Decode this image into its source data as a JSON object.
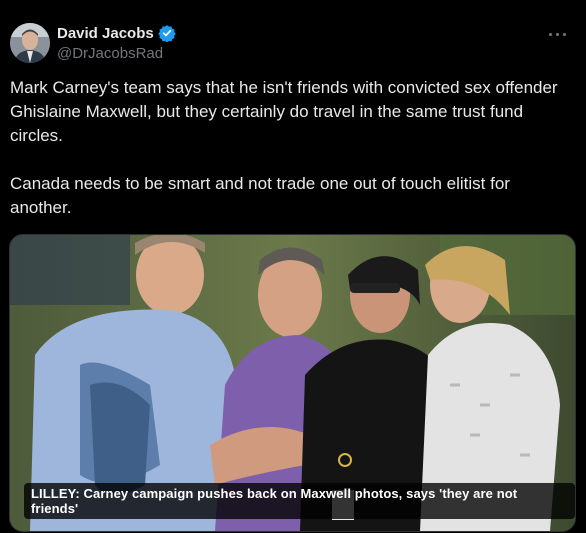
{
  "author": {
    "display_name": "David Jacobs",
    "handle": "@DrJacobsRad",
    "verified": true,
    "verified_color": "#1d9bf0"
  },
  "tweet": {
    "text": "Mark Carney's team says that he isn't friends with convicted sex offender Ghislaine Maxwell, but they certainly do travel in the same trust fund circles.\n\nCanada needs to be smart and not trade one out of touch elitist for another."
  },
  "media": {
    "caption": "LILLEY: Carney campaign pushes back on Maxwell photos, says 'they are not friends'"
  },
  "icons": {
    "more": "more-options-icon",
    "verified": "verified-badge-icon"
  }
}
